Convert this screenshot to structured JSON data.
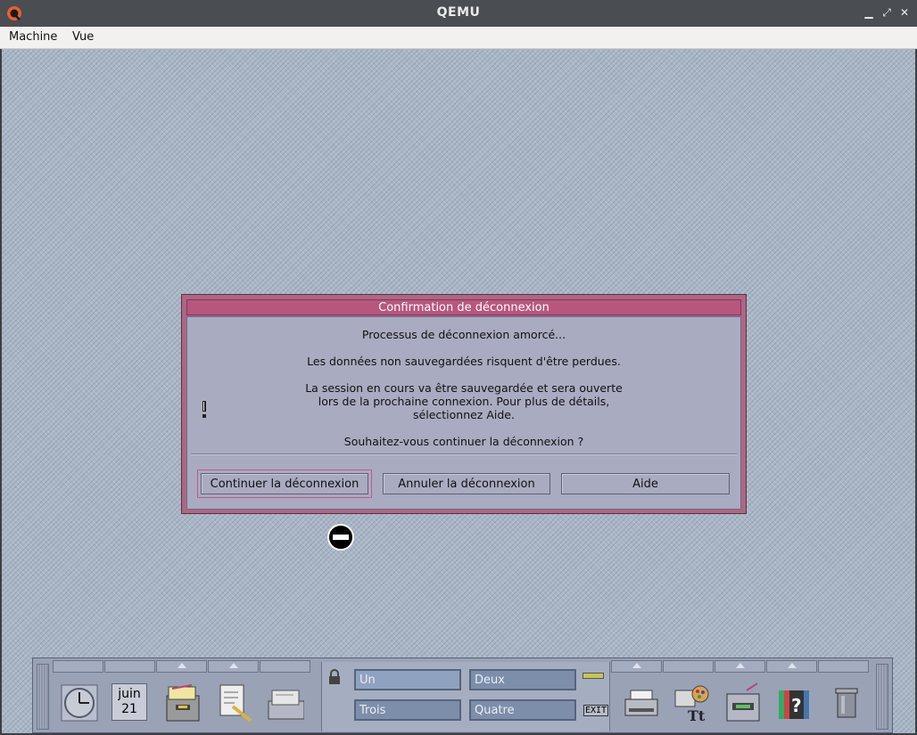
{
  "host": {
    "title": "QEMU",
    "menu": [
      "Machine",
      "Vue"
    ],
    "window_buttons": [
      "minimize-icon",
      "restore-icon",
      "close-icon"
    ]
  },
  "dialog": {
    "title": "Confirmation de déconnexion",
    "line1": "Processus de déconnexion amorcé...",
    "line2": "Les données non sauvegardées risquent d'être perdues.",
    "line3a": "La session en cours va être sauvegardée et sera ouverte",
    "line3b": "lors de la prochaine connexion. Pour plus de détails,",
    "line3c": "sélectionnez Aide.",
    "line4": "Souhaitez-vous continuer la déconnexion ?",
    "buttons": {
      "continue": "Continuer la déconnexion",
      "cancel": "Annuler la déconnexion",
      "help": "Aide"
    }
  },
  "panel": {
    "calendar_month": "juin",
    "calendar_day": "21",
    "workspaces": [
      "Un",
      "Deux",
      "Trois",
      "Quatre"
    ],
    "exit_label": "EXIT",
    "icons_left": [
      "clock-icon",
      "calendar-icon",
      "file-manager-icon",
      "text-editor-icon",
      "mailer-icon"
    ],
    "icons_right": [
      "printer-icon",
      "style-manager-icon",
      "application-manager-icon",
      "help-manager-icon",
      "trash-icon"
    ]
  },
  "colors": {
    "dialog_frame": "#ad6785",
    "dialog_title": "#b8567e",
    "dialog_body": "#a9abc1",
    "panel": "#9aa2b6",
    "workspace_button": "#7c8eaa"
  }
}
